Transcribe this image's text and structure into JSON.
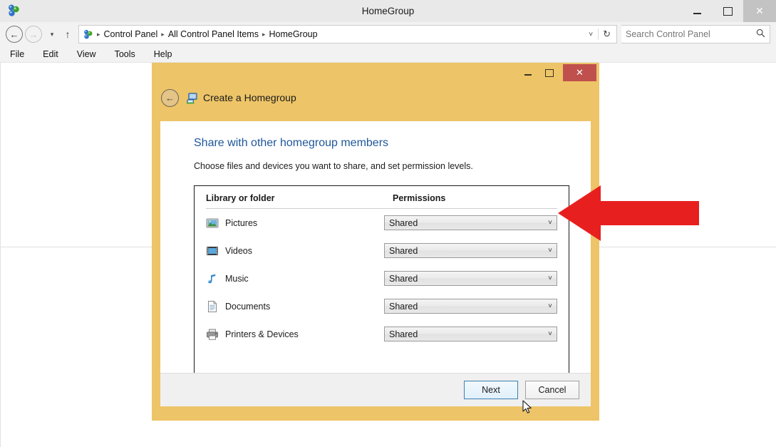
{
  "window": {
    "title": "HomeGroup",
    "icon": "homegroup-icon",
    "controls": {
      "minimize": "–",
      "maximize": "□",
      "close": "✕"
    }
  },
  "nav": {
    "back": "←",
    "forward": "→",
    "history_chevron": "▾",
    "up": "↑",
    "breadcrumb": [
      {
        "label": "Control Panel"
      },
      {
        "label": "All Control Panel Items"
      },
      {
        "label": "HomeGroup"
      }
    ],
    "separator": "▸",
    "address_chevron": "˅",
    "refresh": "↻"
  },
  "search": {
    "placeholder": "Search Control Panel",
    "icon": "🔍"
  },
  "menubar": {
    "items": [
      {
        "label": "File"
      },
      {
        "label": "Edit"
      },
      {
        "label": "View"
      },
      {
        "label": "Tools"
      },
      {
        "label": "Help"
      }
    ]
  },
  "dialog": {
    "title": "Create a Homegroup",
    "back_arrow": "←",
    "controls": {
      "minimize": "–",
      "maximize": "□",
      "close": "✕"
    },
    "heading": "Share with other homegroup members",
    "subtext": "Choose files and devices you want to share, and set permission levels.",
    "table": {
      "headers": {
        "name": "Library or folder",
        "permissions": "Permissions"
      },
      "rows": [
        {
          "name": "Pictures",
          "icon": "pictures-icon",
          "permission": "Shared"
        },
        {
          "name": "Videos",
          "icon": "videos-icon",
          "permission": "Shared"
        },
        {
          "name": "Music",
          "icon": "music-icon",
          "permission": "Shared"
        },
        {
          "name": "Documents",
          "icon": "documents-icon",
          "permission": "Shared"
        },
        {
          "name": "Printers & Devices",
          "icon": "printers-icon",
          "permission": "Shared"
        }
      ]
    },
    "buttons": {
      "next": "Next",
      "cancel": "Cancel"
    }
  },
  "annotation": {
    "type": "arrow-left",
    "color": "#e81f1f"
  },
  "colors": {
    "dialog_frame": "#edc467",
    "dialog_close": "#c0504d",
    "heading_blue": "#1f5799",
    "arrow_red": "#e81f1f"
  }
}
